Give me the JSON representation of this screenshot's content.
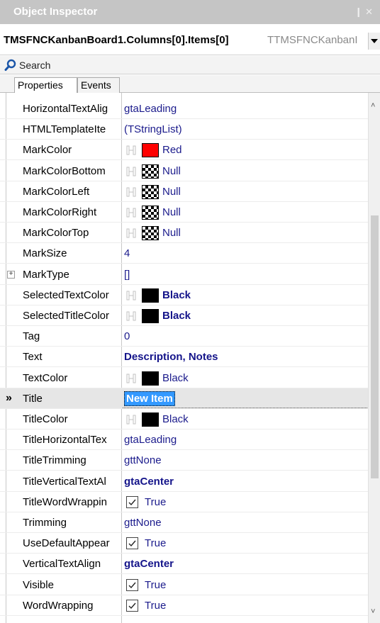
{
  "window": {
    "title": "Object Inspector",
    "pin_glyph": "❙",
    "close_glyph": "✕"
  },
  "object_selector": {
    "name": "TMSFNCKanbanBoard1.Columns[0].Items[0]",
    "type": "TTMSFNCKanbanI"
  },
  "search": {
    "label": "Search"
  },
  "tabs": [
    {
      "label": "Properties",
      "active": true
    },
    {
      "label": "Events",
      "active": false
    }
  ],
  "scrollbar": {
    "up_glyph": "˄",
    "down_glyph": "˅",
    "thumb_position": 0.38,
    "thumb_size": 0.62
  },
  "colors": {
    "red": "#ff0000",
    "black": "#000000",
    "value_text": "#1b1b8c",
    "selection_highlight": "#3399ff"
  },
  "properties": [
    {
      "name": "HorizontalTextAlig",
      "value": "gtaLeading",
      "kind": "text"
    },
    {
      "name": "HTMLTemplateIte",
      "value": "(TStringList)",
      "kind": "text"
    },
    {
      "name": "MarkColor",
      "value": "Red",
      "kind": "color",
      "swatch": "#ff0000"
    },
    {
      "name": "MarkColorBottom",
      "value": "Null",
      "kind": "color",
      "swatch": "checker"
    },
    {
      "name": "MarkColorLeft",
      "value": "Null",
      "kind": "color",
      "swatch": "checker"
    },
    {
      "name": "MarkColorRight",
      "value": "Null",
      "kind": "color",
      "swatch": "checker"
    },
    {
      "name": "MarkColorTop",
      "value": "Null",
      "kind": "color",
      "swatch": "checker"
    },
    {
      "name": "MarkSize",
      "value": "4",
      "kind": "text"
    },
    {
      "name": "MarkType",
      "value": "[]",
      "kind": "text",
      "expander": "+"
    },
    {
      "name": "SelectedTextColor",
      "value": "Black",
      "kind": "color",
      "swatch": "#000000",
      "bold": true
    },
    {
      "name": "SelectedTitleColor",
      "value": "Black",
      "kind": "color",
      "swatch": "#000000",
      "bold": true
    },
    {
      "name": "Tag",
      "value": "0",
      "kind": "text"
    },
    {
      "name": "Text",
      "value": "Description, Notes",
      "kind": "text",
      "bold": true
    },
    {
      "name": "TextColor",
      "value": "Black",
      "kind": "color",
      "swatch": "#000000"
    },
    {
      "name": "Title",
      "value": "New Item",
      "kind": "edit",
      "selected": true,
      "marker": "»"
    },
    {
      "name": "TitleColor",
      "value": "Black",
      "kind": "color",
      "swatch": "#000000"
    },
    {
      "name": "TitleHorizontalTex",
      "value": "gtaLeading",
      "kind": "text"
    },
    {
      "name": "TitleTrimming",
      "value": "gttNone",
      "kind": "text"
    },
    {
      "name": "TitleVerticalTextAl",
      "value": "gtaCenter",
      "kind": "text",
      "bold": true
    },
    {
      "name": "TitleWordWrappin",
      "value": "True",
      "kind": "check"
    },
    {
      "name": "Trimming",
      "value": "gttNone",
      "kind": "text"
    },
    {
      "name": "UseDefaultAppear",
      "value": "True",
      "kind": "check"
    },
    {
      "name": "VerticalTextAlign",
      "value": "gtaCenter",
      "kind": "text",
      "bold": true
    },
    {
      "name": "Visible",
      "value": "True",
      "kind": "check"
    },
    {
      "name": "WordWrapping",
      "value": "True",
      "kind": "check"
    }
  ]
}
